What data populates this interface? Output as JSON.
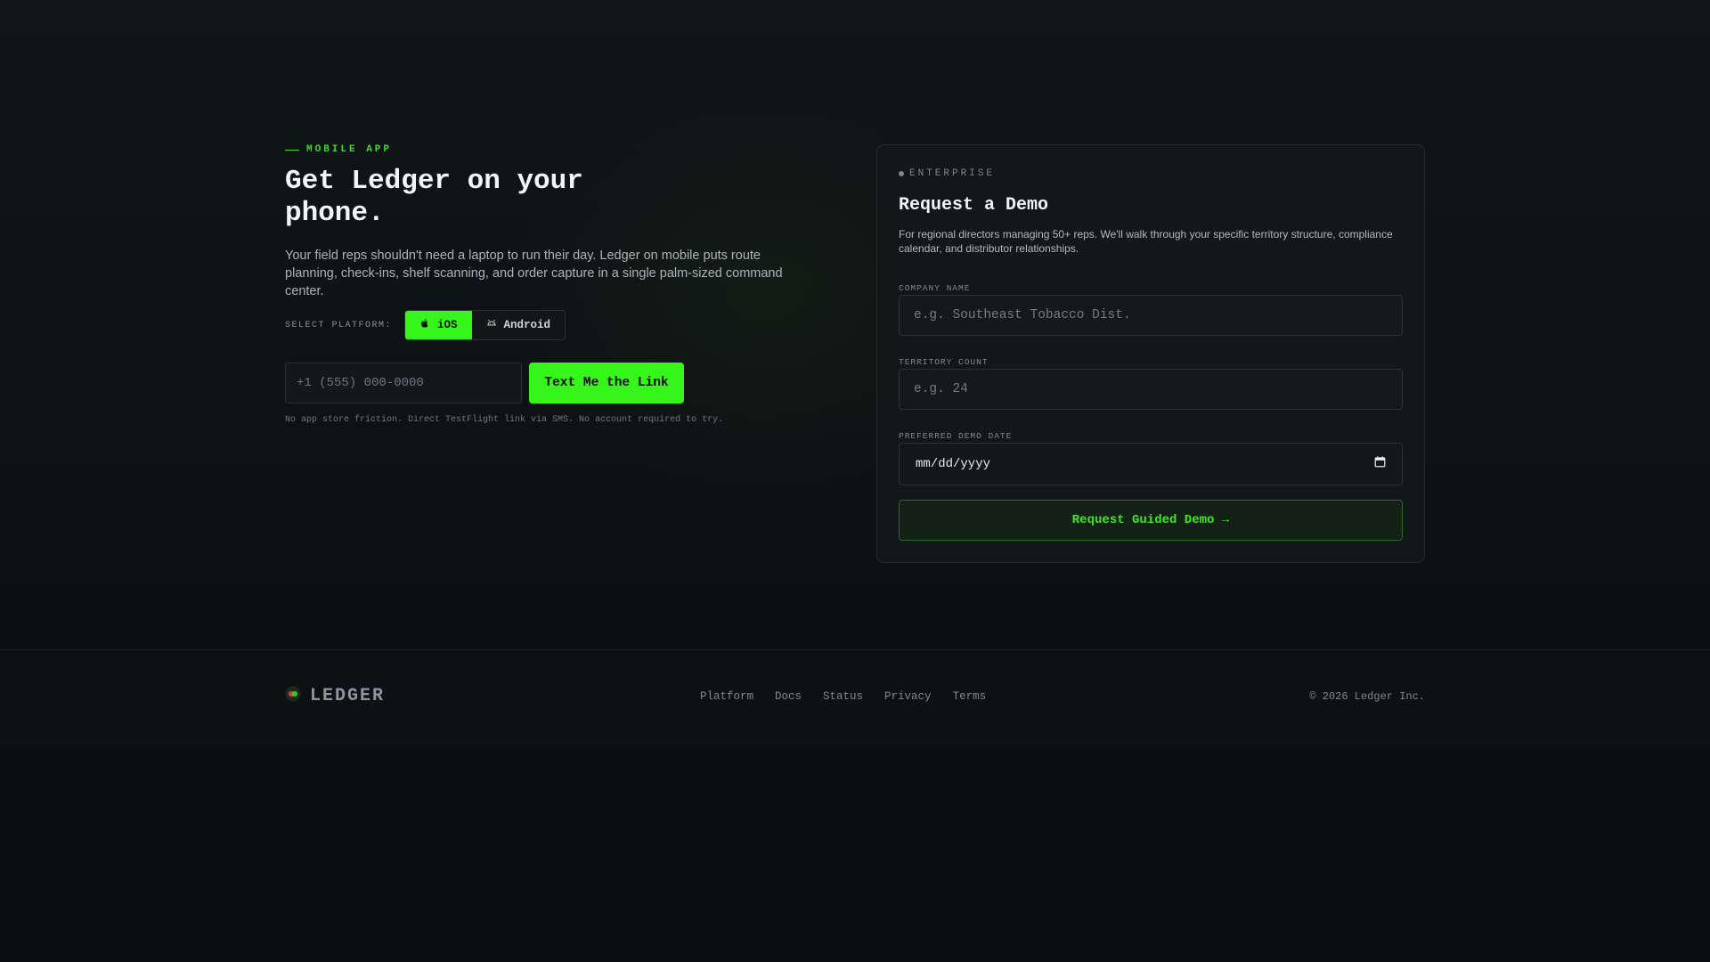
{
  "mobile": {
    "eyebrow": "MOBILE APP",
    "headline": "Get Ledger on your phone.",
    "lede": "Your field reps shouldn't need a laptop to run their day. Ledger on mobile puts route planning, check-ins, shelf scanning, and order capture in a single palm-sized command center.",
    "platform_label": "SELECT PLATFORM:",
    "platforms": [
      {
        "label": "iOS",
        "icon": "apple-icon",
        "selected": true
      },
      {
        "label": "Android",
        "icon": "android-icon",
        "selected": false
      }
    ],
    "phone_placeholder": "+1 (555) 000-0000",
    "send_label": "Text Me the Link",
    "fineprint": "No app store friction. Direct TestFlight link via SMS. No account required to try."
  },
  "enterprise": {
    "eyebrow": "ENTERPRISE",
    "title": "Request a Demo",
    "description": "For regional directors managing 50+ reps. We'll walk through your specific territory structure, compliance calendar, and distributor relationships.",
    "company_label": "COMPANY NAME",
    "company_placeholder": "e.g. Southeast Tobacco Dist.",
    "territory_label": "TERRITORY COUNT",
    "territory_placeholder": "e.g. 24",
    "date_label": "PREFERRED DEMO DATE",
    "date_placeholder": "mm/dd/yyyy",
    "submit_label": "Request Guided Demo →"
  },
  "footer": {
    "brand": "LEDGER",
    "links": [
      "Platform",
      "Docs",
      "Status",
      "Privacy",
      "Terms"
    ],
    "copyright": "© 2026 Ledger Inc."
  },
  "colors": {
    "accent": "#35f51a",
    "background": "#0c0d0e",
    "card": "#121719"
  }
}
